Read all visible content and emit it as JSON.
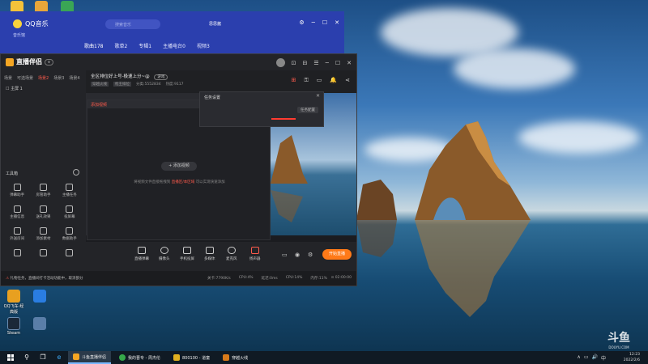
{
  "desktop": {
    "icons": [
      {
        "label": "",
        "color": "#f3c23a"
      },
      {
        "label": "",
        "color": "#e8a63a"
      },
      {
        "label": "",
        "color": "#3aa655"
      },
      {
        "label": "QQ飞车-经典版",
        "color": "#e8a020"
      },
      {
        "label": "",
        "color": "#2a7de1"
      },
      {
        "label": "Steam",
        "color": "#1b2838"
      },
      {
        "label": "",
        "color": "#5a7ea8"
      }
    ]
  },
  "qq_music": {
    "title": "QQ音乐",
    "subtitle": "音乐馆",
    "search_placeholder": "搜索音乐",
    "user": "思思酱",
    "nav": [
      "歌曲178",
      "歌单2",
      "专辑1",
      "主播电台0",
      "视频3"
    ],
    "window_buttons": [
      "⚙",
      "─",
      "☐",
      "✕"
    ],
    "brand_color": "#2b3fae"
  },
  "app": {
    "name": "直播伴侣",
    "badge": "",
    "titlebar_icons": [
      "⊡",
      "⊟",
      "☰",
      "─",
      "☐",
      "✕"
    ],
    "sidebar": {
      "tabs": [
        "场景",
        "可选场景",
        "场景2",
        "场景3",
        "场景4"
      ],
      "active_tab": "场景2",
      "scene_item": "☐ 主屏 1",
      "tools_title": "工具箱",
      "tools": [
        "弹幕助手",
        "房管助手",
        "主播任务",
        "主播信息",
        "送礼效果",
        "投屏幕",
        "外送房间",
        "添加素材",
        "数据助手",
        "",
        "",
        ""
      ]
    },
    "room": {
      "title": "全区排位好上号-极速上分~@",
      "tag": "游戏",
      "meta": [
        "穿越火线",
        "枪王排位",
        "分类:5552834",
        "热度:9117"
      ],
      "icons": [
        "⊞",
        "⚿",
        "▭",
        "🔔",
        "⋖"
      ]
    },
    "dialog": {
      "title": "添加视频",
      "close": "✕",
      "add_button": "+ 添加视频",
      "hint_prefix": "将视频文件直接拖拽到",
      "hint_link": "直播区/本区域",
      "hint_suffix": "可以实现快速添加"
    },
    "task_settings": {
      "title": "任务设置",
      "close": "✕",
      "button": "任务配置"
    },
    "controls": [
      {
        "label": "直播弹幕",
        "red": false
      },
      {
        "label": "摄像头",
        "red": false
      },
      {
        "label": "手机投屏",
        "red": false
      },
      {
        "label": "多媒体",
        "red": false
      },
      {
        "label": "麦克风",
        "red": false
      },
      {
        "label": "扬声器",
        "red": true
      }
    ],
    "go_live": "开始直播",
    "status": {
      "message": "礼物任务，直播间打卡活动功能中，取消部分",
      "stats": [
        "关卡:7790K/s",
        "CPU:4%",
        "延迟:0ms",
        "CPU:14%",
        "内存:11%"
      ],
      "time": "⊙ 02:00:00"
    },
    "accent_color": "#ff5b4c"
  },
  "taskbar": {
    "items": [
      {
        "label": "斗鱼直播伴侣",
        "color": "#f5a623",
        "active": true
      },
      {
        "label": "我的晋专 - 周杰伦",
        "color": "#35a84a",
        "active": false
      },
      {
        "label": "800100 - 道童",
        "color": "#e0b020",
        "active": false
      },
      {
        "label": "穿越火线",
        "color": "#d87a1a",
        "active": false
      }
    ],
    "tray_icons": [
      "∧",
      "▭",
      "🔊",
      "中"
    ],
    "clock": "12:23",
    "date": "2022/2/6"
  },
  "watermark": {
    "text": "斗鱼",
    "sub": "DOUYU.COM"
  }
}
